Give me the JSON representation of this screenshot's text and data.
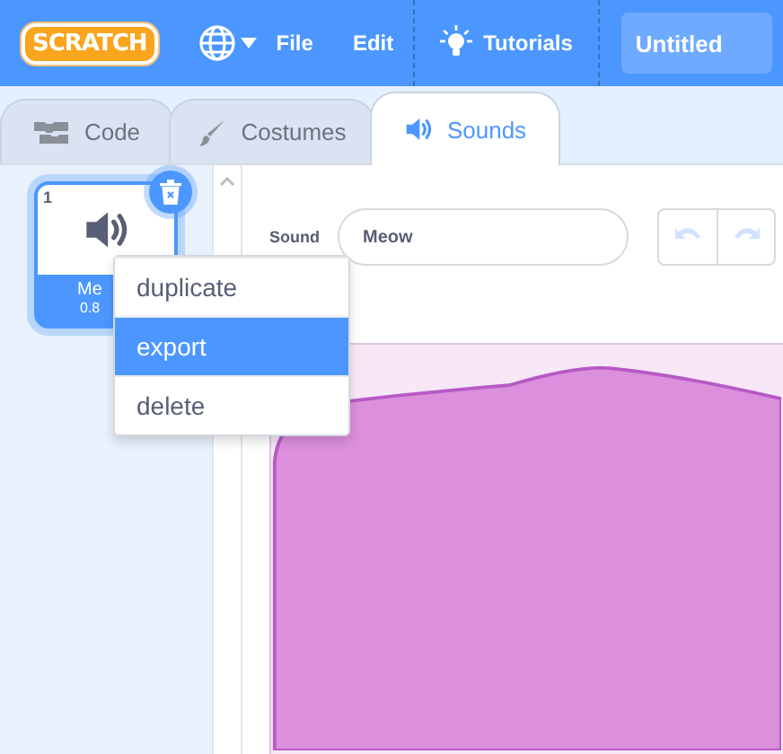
{
  "menu_bar": {
    "logo": "SCRATCH",
    "items": [
      {
        "label": "File"
      },
      {
        "label": "Edit"
      },
      {
        "label": "Tutorials"
      }
    ],
    "project_title": "Untitled"
  },
  "tabs": [
    {
      "label": "Code",
      "selected": false
    },
    {
      "label": "Costumes",
      "selected": false
    },
    {
      "label": "Sounds",
      "selected": true
    }
  ],
  "sound_list": [
    {
      "number": "1",
      "name": "Me",
      "duration": "0.8",
      "selected": true
    }
  ],
  "editor": {
    "sound_label": "Sound",
    "sound_name": "Meow"
  },
  "context_menu": [
    {
      "label": "duplicate",
      "selected": false
    },
    {
      "label": "export",
      "selected": true
    },
    {
      "label": "delete",
      "selected": false
    }
  ]
}
